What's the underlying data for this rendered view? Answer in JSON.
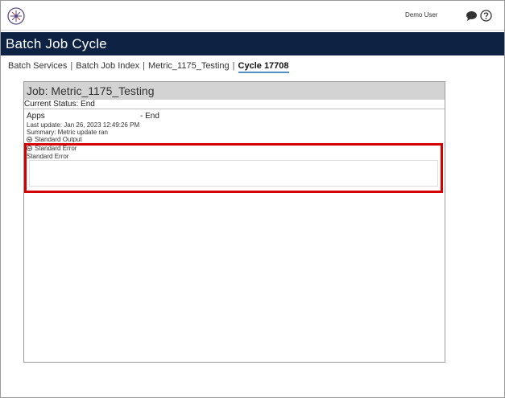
{
  "header": {
    "user_name": "Demo User",
    "logo_icon": "compass-logo-icon",
    "chat_icon": "speech-bubble-icon",
    "help_icon": "help-circle-icon"
  },
  "page": {
    "title": "Batch Job Cycle"
  },
  "breadcrumb": {
    "items": [
      "Batch Services",
      "Batch Job Index",
      "Metric_1175_Testing",
      "Cycle 17708"
    ],
    "separator": "|"
  },
  "job": {
    "title": "Job: Metric_1175_Testing",
    "current_status": "Current Status: End",
    "app": {
      "name": "Apps",
      "status": "- End",
      "last_update": "Last update: Jan 26, 2023 12:49:26 PM",
      "summary": "Summary: Metric update ran"
    },
    "standard_output_toggle": "Standard Output",
    "standard_error_toggle": "Standard Error",
    "standard_error_label": "Standard Error",
    "standard_error_value": ""
  },
  "colors": {
    "title_bar": "#0e2344",
    "highlight": "#d40000",
    "active_underline": "#4f8fc8"
  }
}
